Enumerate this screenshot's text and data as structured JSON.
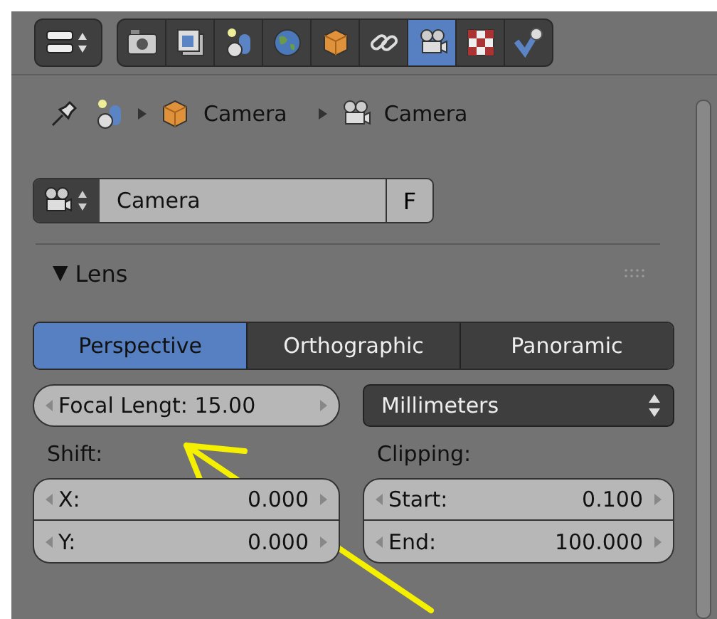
{
  "toolbar": {
    "tabs": [
      {
        "kind": "camera",
        "selected": false
      },
      {
        "kind": "images",
        "selected": false
      },
      {
        "kind": "shapes",
        "selected": false
      },
      {
        "kind": "globe",
        "selected": false
      },
      {
        "kind": "cube",
        "selected": false
      },
      {
        "kind": "chain",
        "selected": false
      },
      {
        "kind": "movie-camera",
        "selected": true
      },
      {
        "kind": "checker",
        "selected": false
      },
      {
        "kind": "check",
        "selected": false
      }
    ]
  },
  "breadcrumb": [
    {
      "kind": "shapes"
    },
    {
      "kind": "cube",
      "label": "Camera"
    },
    {
      "kind": "movie-camera",
      "label": "Camera"
    }
  ],
  "datablock": {
    "name": "Camera",
    "fake_user": "F"
  },
  "panel": {
    "toggle": "▼",
    "title": "Lens",
    "projection": [
      {
        "label": "Perspective",
        "selected": true
      },
      {
        "label": "Orthographic",
        "selected": false
      },
      {
        "label": "Panoramic",
        "selected": false
      }
    ],
    "focal_length": {
      "label": "Focal Lengt:",
      "value": "15.00"
    },
    "unit": "Millimeters",
    "shift": {
      "label": "Shift:",
      "fields": [
        {
          "label": "X:",
          "value": "0.000"
        },
        {
          "label": "Y:",
          "value": "0.000"
        }
      ]
    },
    "clipping": {
      "label": "Clipping:",
      "fields": [
        {
          "label": "Start:",
          "value": "0.100"
        },
        {
          "label": "End:",
          "value": "100.000"
        }
      ]
    }
  }
}
